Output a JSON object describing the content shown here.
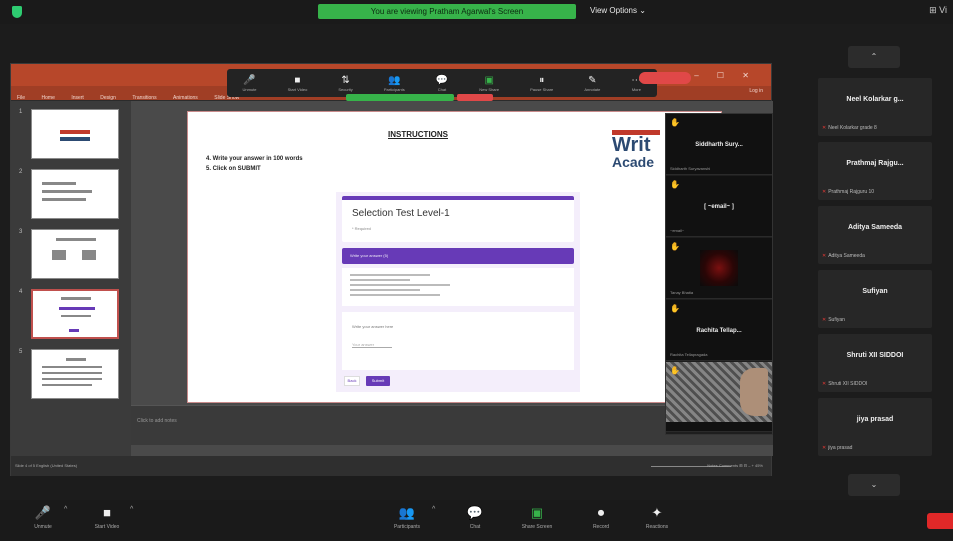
{
  "top": {
    "share_banner": "You are viewing Pratham Agarwal's Screen",
    "view_options": "View Options ⌄",
    "right_icon": "⊞ Vi"
  },
  "ppt": {
    "ribbon_tabs": [
      "File",
      "Home",
      "Insert",
      "Design",
      "Transitions",
      "Animations",
      "Slide Show"
    ],
    "login": "Log in",
    "zoom_toolbar": [
      {
        "icon": "🎤",
        "label": "Unmute",
        "name": "unmute"
      },
      {
        "icon": "■",
        "label": "Start Video",
        "name": "start-video"
      },
      {
        "icon": "⇅",
        "label": "Security",
        "name": "security"
      },
      {
        "icon": "👥",
        "label": "Participants",
        "name": "participants"
      },
      {
        "icon": "💬",
        "label": "Chat",
        "name": "chat"
      },
      {
        "icon": "▣",
        "label": "New Share",
        "name": "new-share"
      },
      {
        "icon": "⏸",
        "label": "Pause Share",
        "name": "pause-share"
      },
      {
        "icon": "✎",
        "label": "Annotate",
        "name": "annotate"
      },
      {
        "icon": "⋯",
        "label": "More",
        "name": "more"
      }
    ],
    "win_buttons": "– ☐ ✕",
    "notes_placeholder": "Click to add notes",
    "status_left": "Slide 4 of 5   English (United States)",
    "status_right": "Notes  Comments  ⊞  ⊟  –  +  45%"
  },
  "slide": {
    "title": "INSTRUCTIONS",
    "step4": "4. Write your answer in 100 words",
    "step5": "5. Click on SUBMIT",
    "brand_line1": "Writ",
    "brand_line2": "Acade"
  },
  "form": {
    "title": "Selection Test Level-1",
    "subtitle": "* Required",
    "section": "Write your answer (5)",
    "question": "Write your answer here",
    "input_placeholder": "Your answer",
    "back": "Back",
    "submit": "Submit"
  },
  "video_panel": {
    "tiles": [
      {
        "name": "Siddharth Sury...",
        "small": "Siddharth Suryavanshi"
      },
      {
        "name": "[ ~email~ ]",
        "small": "~email~"
      },
      {
        "name": "",
        "small": "Tanay Bhatia"
      },
      {
        "name": "Rachita Tellap...",
        "small": "Rachita Tellapragada"
      },
      {
        "name": "",
        "small": ""
      }
    ]
  },
  "gallery": {
    "prev": "⌃",
    "next": "⌄",
    "tiles": [
      {
        "name": "Neel Kolarkar g...",
        "small": "Neel Kolarkar grade 8"
      },
      {
        "name": "Prathmaj Rajgu...",
        "small": "Prathmaj Rajguru 10"
      },
      {
        "name": "Aditya Sameeda",
        "small": "Aditya Sameeda"
      },
      {
        "name": "Sufiyan",
        "small": "Sufiyan"
      },
      {
        "name": "Shruti XII SIDDOI",
        "small": "Shruti XII SIDDOI"
      },
      {
        "name": "jiya prasad",
        "small": "jiya prasad"
      }
    ]
  },
  "bottom": [
    {
      "icon": "🎤",
      "label": "Unmute",
      "name": "unmute"
    },
    {
      "icon": "■",
      "label": "Start Video",
      "name": "start-video"
    },
    {
      "icon": "👥",
      "label": "Participants",
      "name": "participants"
    },
    {
      "icon": "💬",
      "label": "Chat",
      "name": "chat"
    },
    {
      "icon": "▣",
      "label": "Share Screen",
      "name": "share-screen"
    },
    {
      "icon": "⏺",
      "label": "Record",
      "name": "record"
    },
    {
      "icon": "✦",
      "label": "Reactions",
      "name": "reactions"
    }
  ],
  "colors": {
    "zoom_green": "#37b34a",
    "ppt_red": "#b7472a",
    "forms_purple": "#673ab7",
    "end_red": "#e02828"
  }
}
